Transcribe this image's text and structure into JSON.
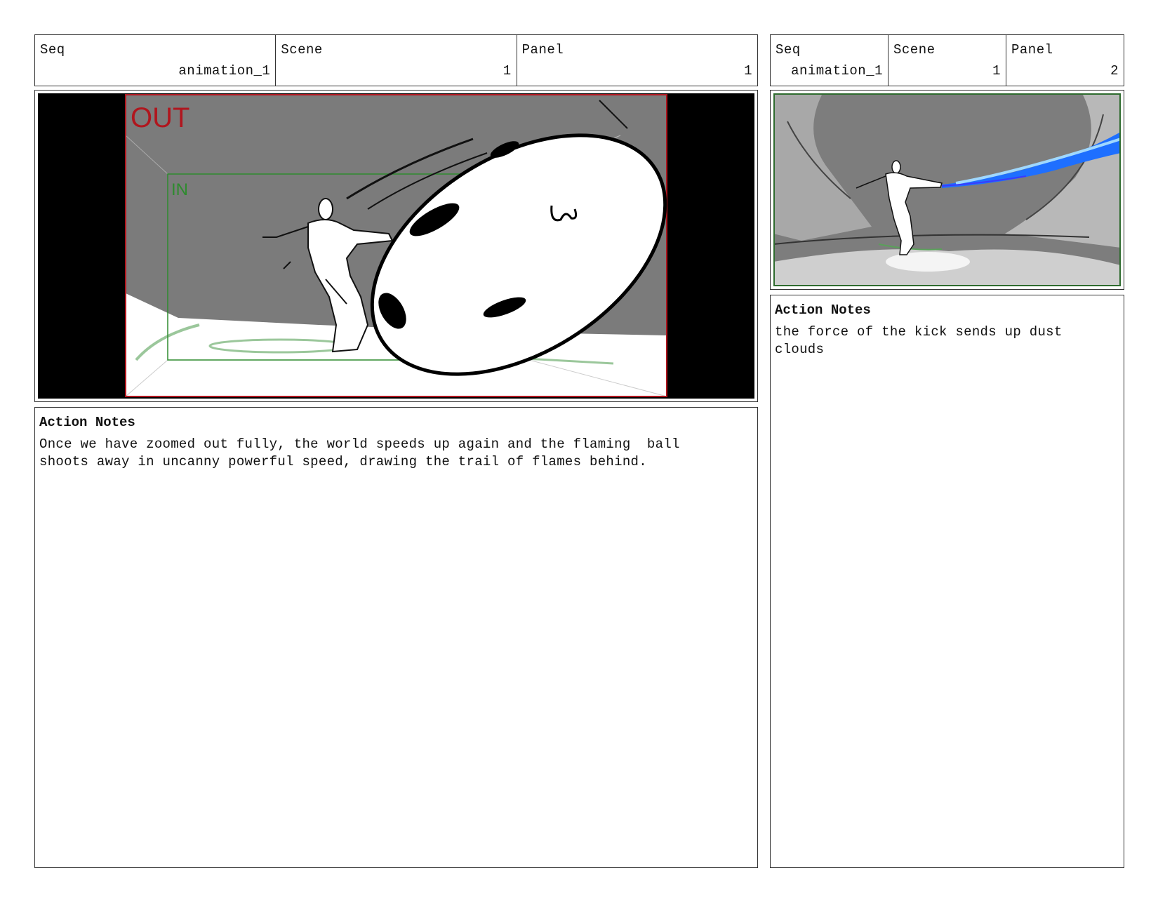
{
  "panels": [
    {
      "header": {
        "seq_label": "Seq",
        "seq_value": "animation_1",
        "scene_label": "Scene",
        "scene_value": "1",
        "panel_label": "Panel",
        "panel_value": "1"
      },
      "frame": {
        "out_label": "OUT",
        "in_label": "IN"
      },
      "notes": {
        "title": "Action Notes",
        "text": "Once we have zoomed out fully, the world speeds up again and the flaming  ball\nshoots away in uncanny powerful speed, drawing the trail of flames behind."
      }
    },
    {
      "header": {
        "seq_label": "Seq",
        "seq_value": "animation_1",
        "scene_label": "Scene",
        "scene_value": "1",
        "panel_label": "Panel",
        "panel_value": "2"
      },
      "notes": {
        "title": "Action Notes",
        "text": "the force of the kick sends up dust\nclouds"
      }
    }
  ],
  "colors": {
    "out_frame": "#b0161e",
    "in_frame": "#2e8b2e",
    "flame": "#1e6fff"
  }
}
